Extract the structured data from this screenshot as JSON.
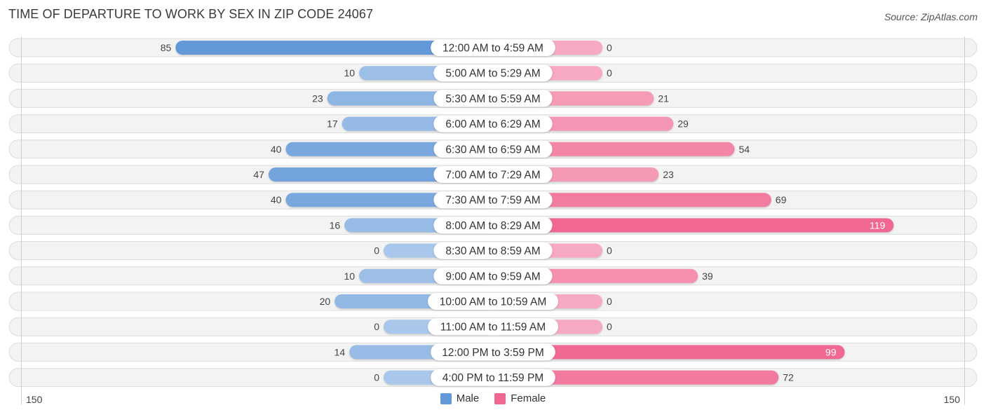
{
  "title": "TIME OF DEPARTURE TO WORK BY SEX IN ZIP CODE 24067",
  "source": "Source: ZipAtlas.com",
  "legend": {
    "male_label": "Male",
    "female_label": "Female"
  },
  "axis": {
    "left_label": "150",
    "right_label": "150"
  },
  "colors": {
    "male_strong": "#6399d8",
    "male_light": "#a9c7ea",
    "female_strong": "#f06892",
    "female_light": "#f6a9c0",
    "track": "#f3f3f3"
  },
  "chart_data": {
    "type": "bar",
    "orientation": "horizontal-diverging",
    "title": "TIME OF DEPARTURE TO WORK BY SEX IN ZIP CODE 24067",
    "xlim": [
      -150,
      150
    ],
    "xlabel": "",
    "ylabel": "",
    "legend_position": "bottom-center",
    "categories": [
      "12:00 AM to 4:59 AM",
      "5:00 AM to 5:29 AM",
      "5:30 AM to 5:59 AM",
      "6:00 AM to 6:29 AM",
      "6:30 AM to 6:59 AM",
      "7:00 AM to 7:29 AM",
      "7:30 AM to 7:59 AM",
      "8:00 AM to 8:29 AM",
      "8:30 AM to 8:59 AM",
      "9:00 AM to 9:59 AM",
      "10:00 AM to 10:59 AM",
      "11:00 AM to 11:59 AM",
      "12:00 PM to 3:59 PM",
      "4:00 PM to 11:59 PM"
    ],
    "series": [
      {
        "name": "Male",
        "values": [
          85,
          10,
          23,
          17,
          40,
          47,
          40,
          16,
          0,
          10,
          20,
          0,
          14,
          0
        ]
      },
      {
        "name": "Female",
        "values": [
          0,
          0,
          21,
          29,
          54,
          23,
          69,
          119,
          0,
          39,
          0,
          0,
          99,
          72
        ]
      }
    ]
  }
}
